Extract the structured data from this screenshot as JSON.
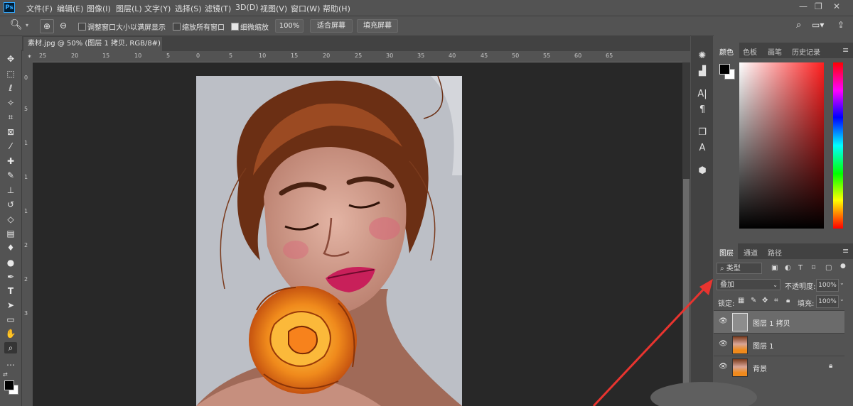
{
  "app": {
    "logo": "Ps"
  },
  "menu": [
    "文件(F)",
    "编辑(E)",
    "图像(I)",
    "图层(L)",
    "文字(Y)",
    "选择(S)",
    "滤镜(T)",
    "3D(D)",
    "视图(V)",
    "窗口(W)",
    "帮助(H)"
  ],
  "options": {
    "resize_windows": "调整窗口大小以满屏显示",
    "zoom_all": "缩放所有窗口",
    "scrubby_zoom": "细微缩放",
    "zoom_value": "100%",
    "fit_screen": "适合屏幕",
    "fill_screen": "填充屏幕"
  },
  "document": {
    "tab_title": "素材.jpg @ 50% (图层 1 拷贝, RGB/8#) *",
    "close": "×"
  },
  "ruler": {
    "h": [
      "25",
      "20",
      "15",
      "10",
      "5",
      "0",
      "5",
      "10",
      "15",
      "20",
      "25",
      "30",
      "35",
      "40",
      "45",
      "50",
      "55",
      "60",
      "65"
    ],
    "v": [
      "0",
      "5",
      "1",
      "1",
      "1",
      "2",
      "2",
      "3"
    ]
  },
  "color_panel": {
    "tabs": [
      "颜色",
      "色板",
      "画笔",
      "历史记录"
    ],
    "active": 0
  },
  "layers_panel": {
    "tabs": [
      "图层",
      "通道",
      "路径"
    ],
    "filter_kind": "类型",
    "blend_mode": "叠加",
    "opacity_label": "不透明度:",
    "opacity_value": "100%",
    "lock_label": "锁定:",
    "fill_label": "填充:",
    "fill_value": "100%",
    "layers": [
      {
        "name": "图层 1 拷贝",
        "selected": true
      },
      {
        "name": "图层 1",
        "selected": false
      },
      {
        "name": "背景",
        "selected": false,
        "locked": true
      }
    ]
  },
  "colors": {
    "accent_arrow": "#e8342f",
    "foreground": "#000000",
    "background": "#ffffff"
  }
}
